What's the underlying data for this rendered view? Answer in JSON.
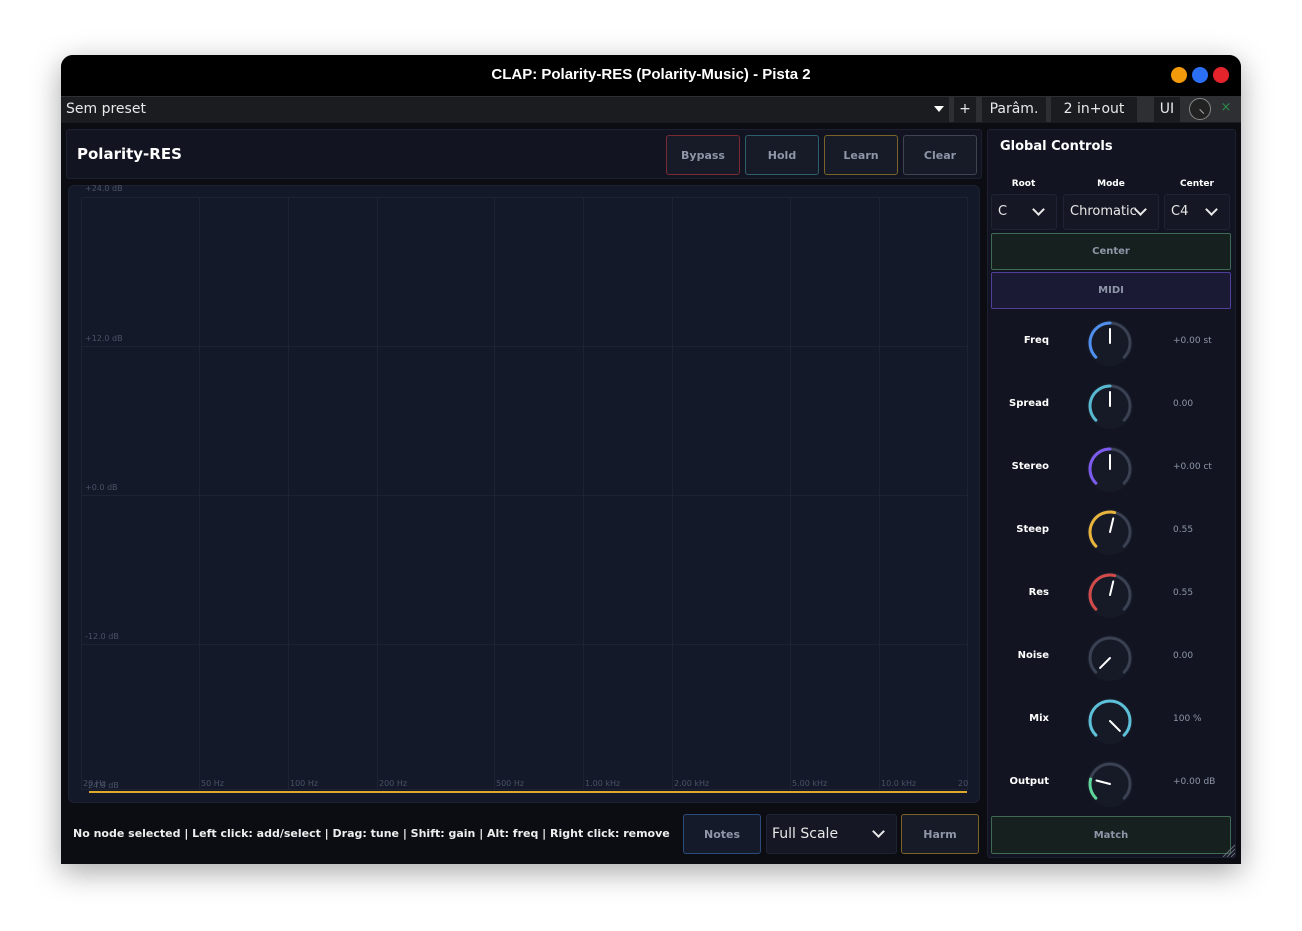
{
  "window": {
    "title": "CLAP: Polarity-RES (Polarity-Music) - Pista 2"
  },
  "host": {
    "preset": "Sem preset",
    "plus": "+",
    "params": "Parâm.",
    "io": "2 in+out",
    "ui": "UI",
    "close": "×"
  },
  "header": {
    "title": "Polarity-RES",
    "bypass": "Bypass",
    "hold": "Hold",
    "learn": "Learn",
    "clear": "Clear"
  },
  "graph": {
    "db_labels": [
      "+24.0 dB",
      "+12.0 dB",
      "+0.0 dB",
      "-12.0 dB",
      "-24.0 dB"
    ],
    "hz_labels": [
      "20 Hz",
      "50 Hz",
      "100 Hz",
      "200 Hz",
      "500 Hz",
      "1.00 kHz",
      "2.00 kHz",
      "5.00 kHz",
      "10.0 kHz",
      "20"
    ]
  },
  "footer": {
    "hint": "No node selected  |  Left click: add/select  |  Drag: tune  |  Shift: gain  |  Alt: freq  |  Right click: remove",
    "notes": "Notes",
    "scale": "Full Scale",
    "harm": "Harm"
  },
  "side": {
    "title": "Global Controls",
    "root_label": "Root",
    "root_value": "C",
    "mode_label": "Mode",
    "mode_value": "Chromatic",
    "center_label": "Center",
    "center_value": "C4",
    "center_button": "Center",
    "midi_button": "MIDI",
    "match_button": "Match",
    "knobs": [
      {
        "label": "Freq",
        "value": "+0.00 st",
        "level": 0.5,
        "color": "#4f8ff0",
        "bipolar": true
      },
      {
        "label": "Spread",
        "value": "0.00",
        "level": 0.5,
        "color": "#58b8cf",
        "bipolar": false
      },
      {
        "label": "Stereo",
        "value": "+0.00 ct",
        "level": 0.5,
        "color": "#7d5af0",
        "bipolar": true
      },
      {
        "label": "Steep",
        "value": "0.55",
        "level": 0.55,
        "color": "#e8b43c",
        "bipolar": false
      },
      {
        "label": "Res",
        "value": "0.55",
        "level": 0.55,
        "color": "#d44a4a",
        "bipolar": false
      },
      {
        "label": "Noise",
        "value": "0.00",
        "level": 0.0,
        "color": "#58b8cf",
        "bipolar": false
      },
      {
        "label": "Mix",
        "value": "100 %",
        "level": 1.0,
        "color": "#5cc0d8",
        "bipolar": false
      },
      {
        "label": "Output",
        "value": "+0.00 dB",
        "level": 0.22,
        "color": "#5ed69a",
        "bipolar": false
      }
    ]
  }
}
